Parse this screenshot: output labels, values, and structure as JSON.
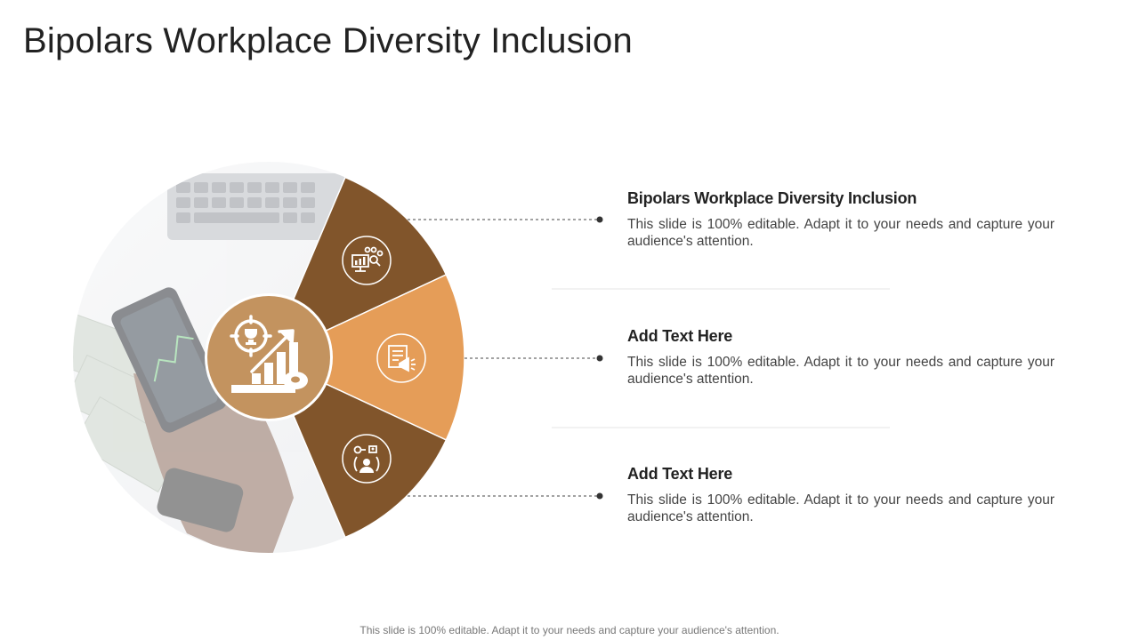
{
  "slide": {
    "title": "Bipolars Workplace Diversity Inclusion",
    "footer": "This slide is 100% editable. Adapt it to your needs and capture your audience's attention."
  },
  "colors": {
    "dark_brown": "#81552B",
    "orange": "#E59D58",
    "center_tan": "#C3935F",
    "connector": "#444444",
    "divider": "#E6E6E6"
  },
  "items": [
    {
      "heading": "Bipolars Workplace Diversity Inclusion",
      "text": "This slide is 100% editable. Adapt it to your needs and capture your audience's attention.",
      "icon": "presentation-analytics-icon"
    },
    {
      "heading": "Add Text Here",
      "text": "This slide is 100% editable. Adapt it to your needs and capture your audience's attention.",
      "icon": "document-megaphone-icon"
    },
    {
      "heading": "Add Text Here",
      "text": "This slide is 100% editable. Adapt it to your needs and capture your audience's attention.",
      "icon": "user-network-icon"
    }
  ],
  "center": {
    "icon": "trophy-growth-chart-icon"
  },
  "background_photo": {
    "description_icon": "hand-smartphone-photo-icon"
  }
}
